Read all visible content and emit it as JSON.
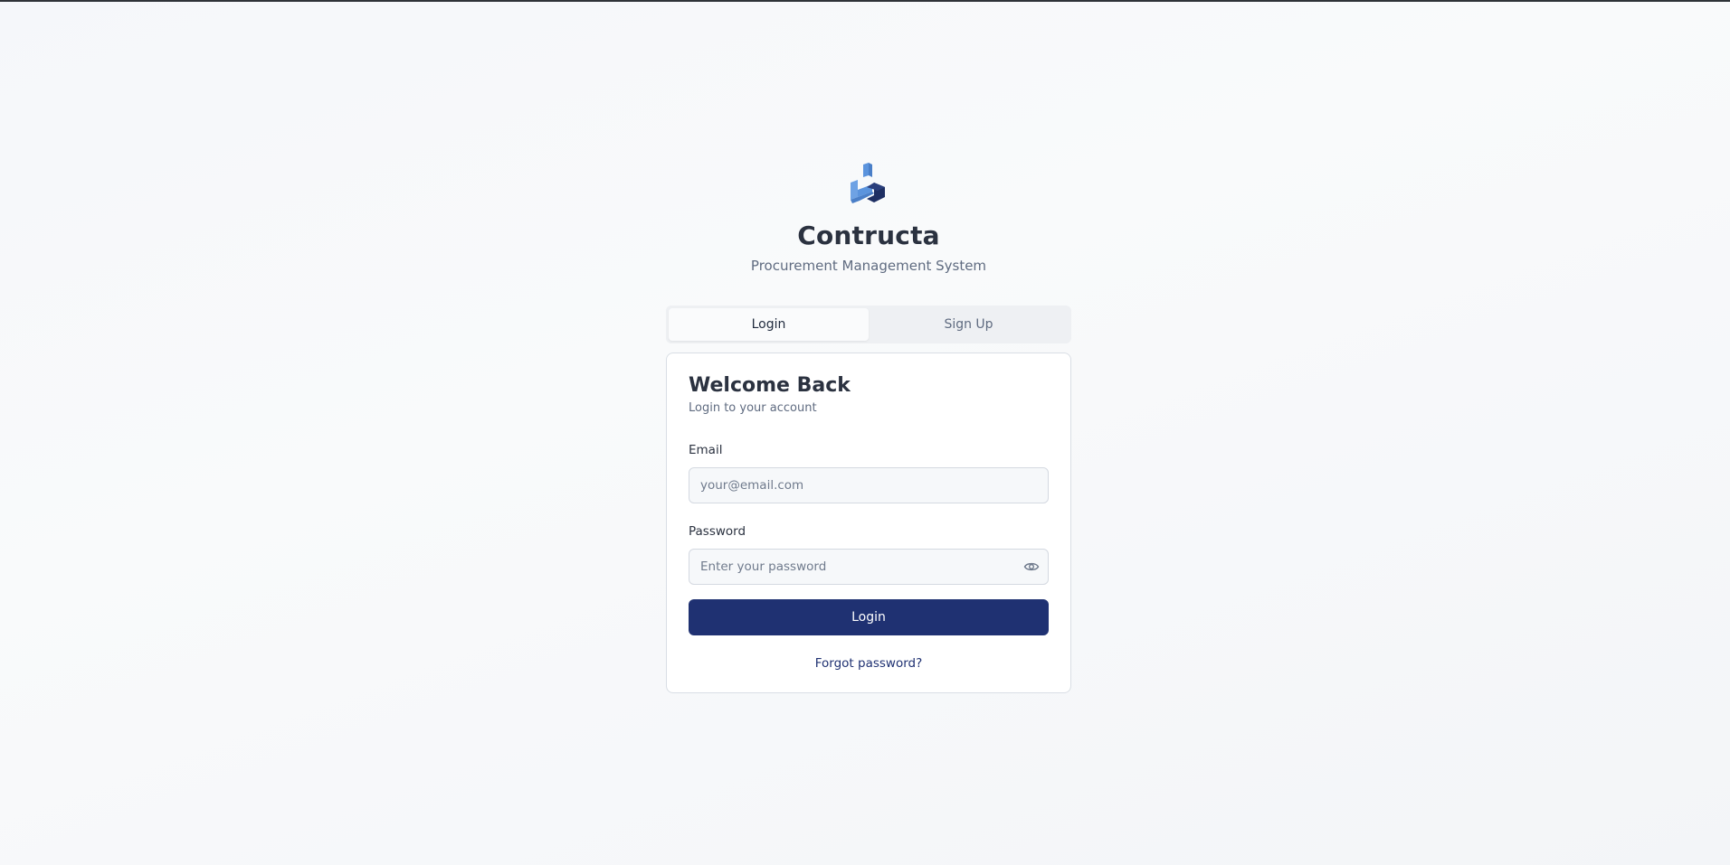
{
  "brand": {
    "logo_icon": "stacked-blocks-logo-icon",
    "title": "Contructa",
    "subtitle": "Procurement Management System"
  },
  "tabs": [
    {
      "label": "Login",
      "active": true
    },
    {
      "label": "Sign Up",
      "active": false
    }
  ],
  "card": {
    "title": "Welcome Back",
    "subtitle": "Login to your account",
    "email": {
      "label": "Email",
      "value": "",
      "placeholder": "your@email.com"
    },
    "password": {
      "label": "Password",
      "value": "",
      "placeholder": "Enter your password",
      "toggle_icon": "eye-icon"
    },
    "submit_label": "Login",
    "forgot_label": "Forgot password?"
  },
  "colors": {
    "primary": "#1f3172",
    "logo_light": "#5b94dd",
    "logo_dark": "#1e2f63",
    "background": "#f5f7fa"
  }
}
